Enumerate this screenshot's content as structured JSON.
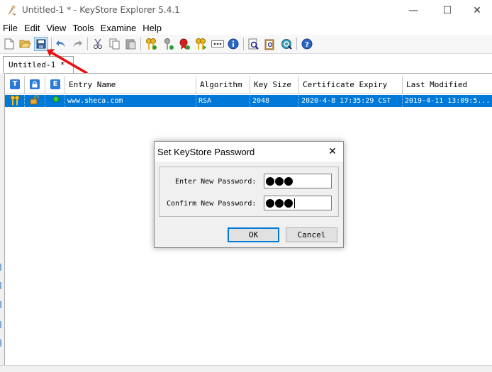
{
  "window": {
    "title": "Untitled-1 * - KeyStore Explorer 5.4.1",
    "minimize_glyph": "—",
    "maximize_glyph": "☐",
    "close_glyph": "✕"
  },
  "menu": [
    "File",
    "Edit",
    "View",
    "Tools",
    "Examine",
    "Help"
  ],
  "toolbar": {
    "icons": [
      "new-icon",
      "open-icon",
      "save-icon",
      "undo-icon",
      "redo-icon",
      "cut-icon",
      "copy-icon",
      "paste-icon",
      "generate-keypair-icon",
      "generate-secret-key-icon",
      "import-trusted-cert-icon",
      "import-keypair-icon",
      "set-password-icon",
      "properties-icon",
      "examine-file-icon",
      "examine-clipboard-icon",
      "examine-ssl-icon",
      "help-icon"
    ],
    "active": "save-icon"
  },
  "tab": {
    "label": "Untitled-1 *"
  },
  "table": {
    "icon_headers": [
      "T",
      "🔒",
      "E"
    ],
    "columns": [
      "Entry Name",
      "Algorithm",
      "Key Size",
      "Certificate Expiry",
      "Last Modified"
    ],
    "rows": [
      {
        "type_icon": "keypair-icon",
        "lock_icon": "unlocked-icon",
        "status_icon": "valid-status-icon",
        "entry_name": "www.sheca.com",
        "algorithm": "RSA",
        "key_size": "2048",
        "expiry": "2020-4-8 17:35:29 CST",
        "modified": "2019-4-11 13:09:5..."
      }
    ]
  },
  "dialog": {
    "title": "Set KeyStore Password",
    "close_glyph": "✕",
    "new_password_label": "Enter New Password:",
    "confirm_password_label": "Confirm New Password:",
    "new_password_length": 3,
    "confirm_password_length": 3,
    "ok_label": "OK",
    "cancel_label": "Cancel"
  },
  "colors": {
    "selection": "#0078d7",
    "accent_red": "#e81010",
    "header_icon_blue": "#2b7bd6"
  }
}
